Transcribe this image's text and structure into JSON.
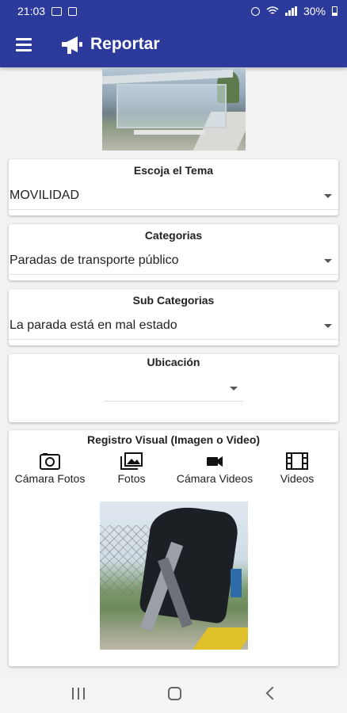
{
  "status_bar": {
    "time": "21:03",
    "battery": "30%",
    "icons": [
      "gallery-icon",
      "download-icon",
      "alarm-icon",
      "wifi-icon",
      "signal-icon",
      "battery-icon"
    ]
  },
  "app_bar": {
    "title": "Reportar",
    "menu_icon": "menu-icon",
    "title_icon": "megaphone-icon",
    "color": "#2b3a9b"
  },
  "form": {
    "tema": {
      "label": "Escoja el Tema",
      "value": "MOVILIDAD"
    },
    "categorias": {
      "label": "Categorias",
      "value": "Paradas de transporte público"
    },
    "sub_categorias": {
      "label": "Sub Categorias",
      "value": "La parada está en mal estado"
    },
    "ubicacion": {
      "label": "Ubicación",
      "value": ""
    }
  },
  "registro": {
    "label": "Registro Visual (Imagen o Video)",
    "buttons": [
      {
        "label": "Cámara Fotos",
        "icon": "camera-icon"
      },
      {
        "label": "Fotos",
        "icon": "photos-icon"
      },
      {
        "label": "Cámara Videos",
        "icon": "video-camera-icon"
      },
      {
        "label": "Videos",
        "icon": "film-icon"
      }
    ]
  },
  "nav_bar": {
    "icons": [
      "recent-apps-icon",
      "home-icon",
      "back-icon"
    ]
  }
}
